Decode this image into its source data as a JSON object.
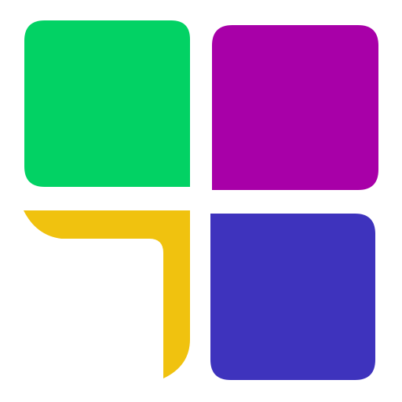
{
  "logo": {
    "icon": "four-quadrant-tile-logo",
    "colors": {
      "background": "#ffffff",
      "top_left": "#02d264",
      "top_right": "#a800a8",
      "bottom_left": "#f0c20f",
      "bottom_right": "#3e33bd"
    }
  }
}
